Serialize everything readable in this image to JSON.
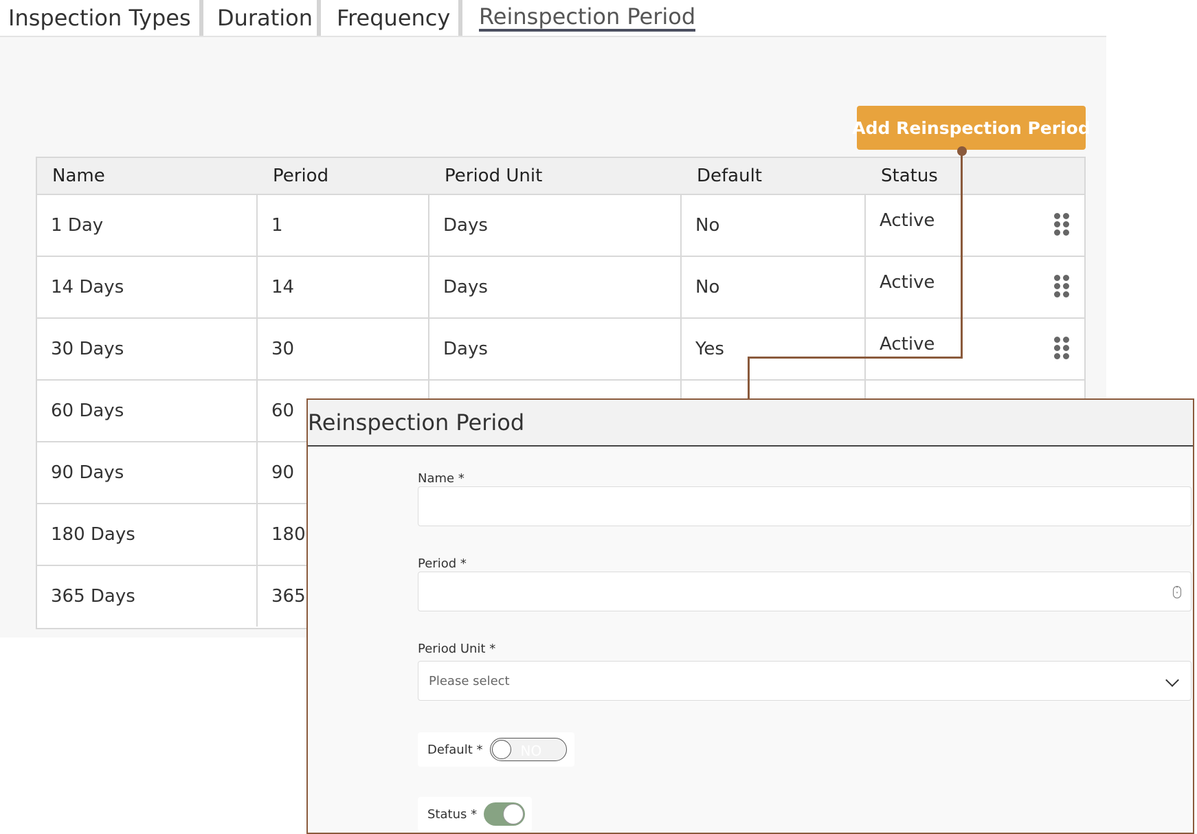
{
  "tabs": [
    {
      "label": "Inspection Types"
    },
    {
      "label": "Duration"
    },
    {
      "label": "Frequency"
    },
    {
      "label": "Reinspection Period"
    }
  ],
  "add_button_label": "Add Reinspection Period",
  "table": {
    "headers": [
      "Name",
      "Period",
      "Period Unit",
      "Default",
      "Status"
    ],
    "rows": [
      {
        "name": "1 Day",
        "period": "1",
        "unit": "Days",
        "default": "No",
        "status": "Active"
      },
      {
        "name": "14 Days",
        "period": "14",
        "unit": "Days",
        "default": "No",
        "status": "Active"
      },
      {
        "name": "30 Days",
        "period": "30",
        "unit": "Days",
        "default": "Yes",
        "status": "Active"
      },
      {
        "name": "60 Days",
        "period": "60"
      },
      {
        "name": "90 Days",
        "period": "90"
      },
      {
        "name": "180 Days",
        "period": "180"
      },
      {
        "name": "365 Days",
        "period": "365"
      }
    ]
  },
  "dialog": {
    "title": "Reinspection Period",
    "name_label": "Name *",
    "name_value": "",
    "period_label": "Period *",
    "period_value": "",
    "unit_label": "Period Unit *",
    "unit_placeholder": "Please select",
    "default_label": "Default *",
    "default_toggle_text": "NO",
    "status_label": "Status *"
  },
  "colors": {
    "accent": "#e8a33d",
    "connector": "#8a5a3c",
    "toggle_on": "#87a383"
  }
}
